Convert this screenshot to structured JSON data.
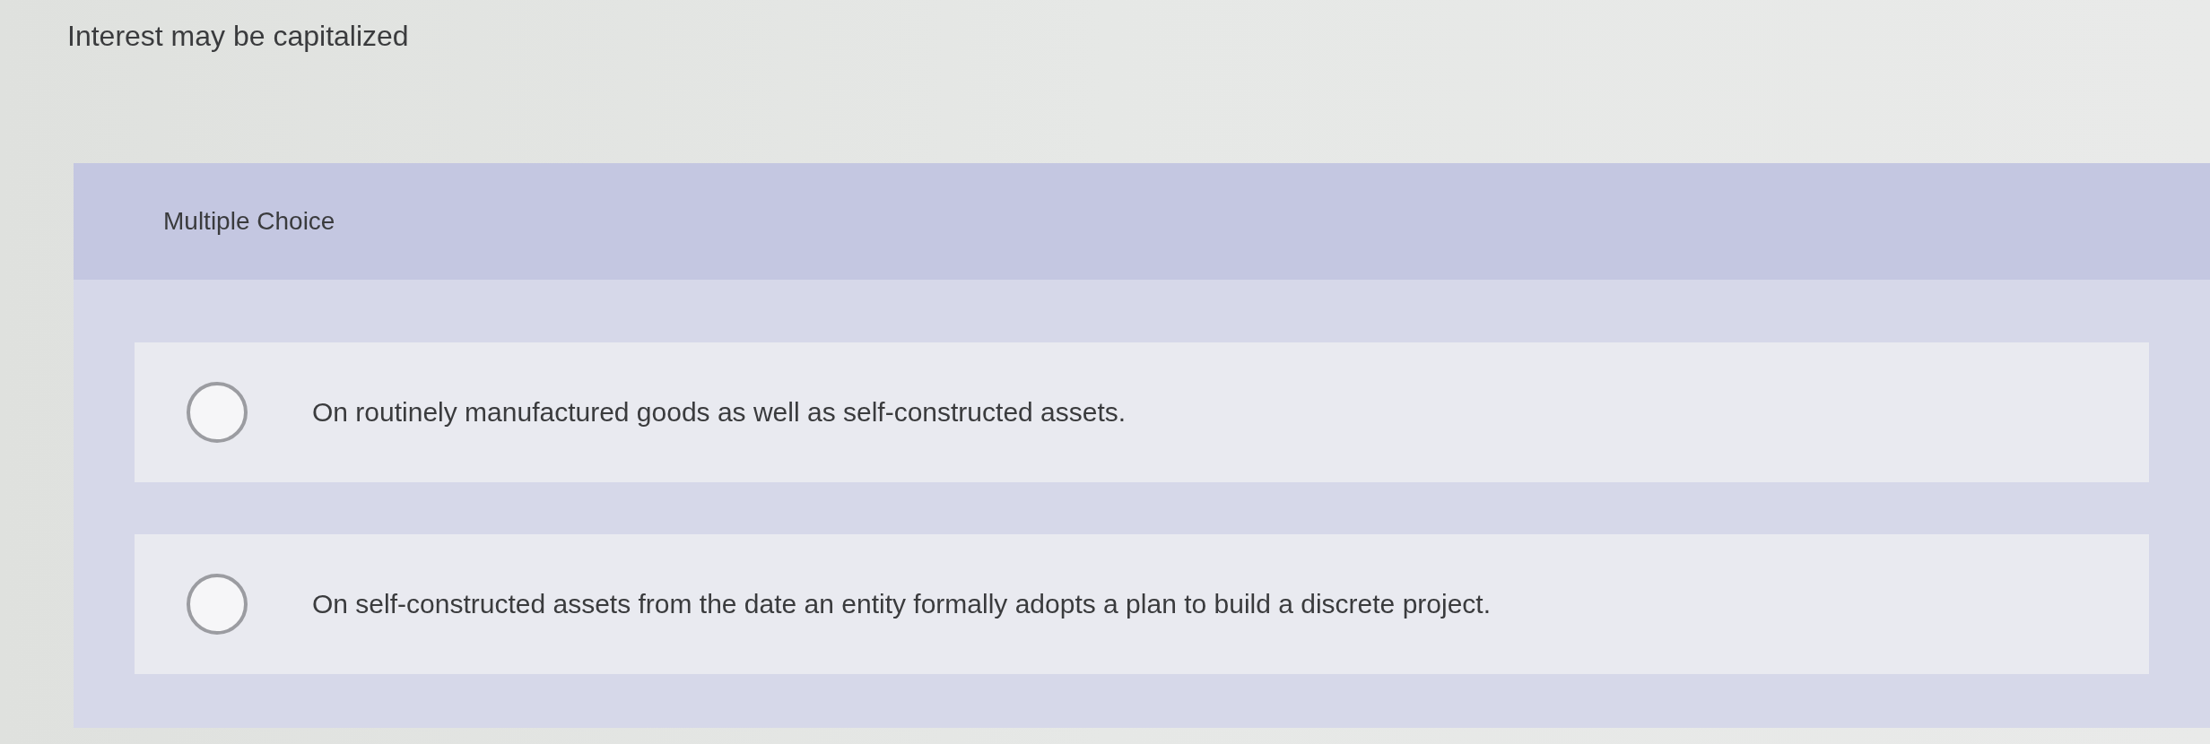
{
  "question": {
    "text": "Interest may be capitalized"
  },
  "section": {
    "label": "Multiple Choice"
  },
  "options": [
    {
      "text": "On routinely manufactured goods as well as self-constructed assets.",
      "selected": false
    },
    {
      "text": "On self-constructed assets from the date an entity formally adopts a plan to build a discrete project.",
      "selected": false
    }
  ]
}
